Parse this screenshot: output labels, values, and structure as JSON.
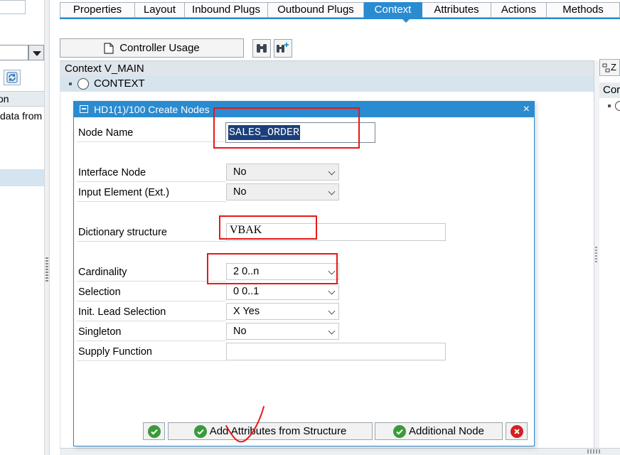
{
  "left_panel": {
    "header_partial": "tion",
    "row_partial": "data from"
  },
  "tabs": [
    {
      "label": "Properties",
      "active": false
    },
    {
      "label": "Layout",
      "active": false
    },
    {
      "label": "Inbound Plugs",
      "active": false
    },
    {
      "label": "Outbound Plugs",
      "active": false
    },
    {
      "label": "Context",
      "active": true
    },
    {
      "label": "Attributes",
      "active": false
    },
    {
      "label": "Actions",
      "active": false
    },
    {
      "label": "Methods",
      "active": false
    }
  ],
  "toolbar": {
    "controller_usage_label": "Controller Usage",
    "icons": [
      "binoculars-icon",
      "binoculars-plus-icon"
    ]
  },
  "context": {
    "header": "Context V_MAIN",
    "root_node": "CONTEXT"
  },
  "right_panel": {
    "header_partial": "Z",
    "row_partial": "Cor"
  },
  "dialog": {
    "title": "HD1(1)/100 Create Nodes",
    "close_glyph": "×",
    "fields": {
      "node_name": {
        "label": "Node Name",
        "value": "SALES_ORDER"
      },
      "interface_node": {
        "label": "Interface Node",
        "value": "No"
      },
      "input_element": {
        "label": "Input Element (Ext.)",
        "value": "No"
      },
      "dictionary_structure": {
        "label": "Dictionary structure",
        "value": "VBAK"
      },
      "cardinality": {
        "label": "Cardinality",
        "value": "2 0..n"
      },
      "selection": {
        "label": "Selection",
        "value": "0 0..1"
      },
      "init_lead_selection": {
        "label": "Init. Lead Selection",
        "value": "X Yes"
      },
      "singleton": {
        "label": "Singleton",
        "value": "No"
      },
      "supply_function": {
        "label": "Supply Function",
        "value": ""
      }
    },
    "buttons": {
      "add_attributes": "Add Attributes from Structure",
      "additional_node": "Additional Node"
    }
  },
  "colors": {
    "accent": "#2a8bd0",
    "selection_row": "#d6e4ee",
    "annotation_red": "#e81818"
  }
}
